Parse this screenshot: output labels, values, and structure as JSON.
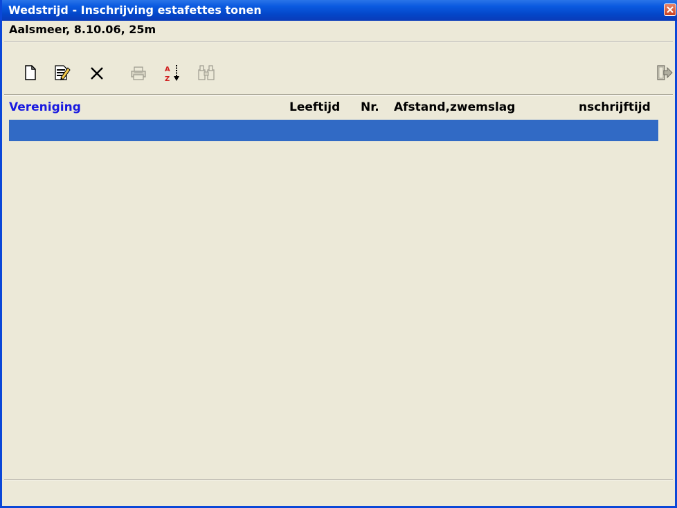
{
  "window": {
    "title": "Wedstrijd - Inschrijving estafettes tonen",
    "subtitle": "Aalsmeer, 8.10.06, 25m"
  },
  "toolbar": {
    "buttons": [
      {
        "name": "new-document-icon",
        "enabled": true
      },
      {
        "name": "edit-document-icon",
        "enabled": true
      },
      {
        "name": "delete-icon",
        "enabled": true
      },
      {
        "name": "printer-icon",
        "enabled": false
      },
      {
        "name": "sort-az-icon",
        "enabled": true
      },
      {
        "name": "binoculars-icon",
        "enabled": false
      },
      {
        "name": "exit-icon",
        "enabled": true
      }
    ]
  },
  "table": {
    "columns": [
      "Vereniging",
      "Leeftijd",
      "Nr.",
      "Afstand,zwemslag",
      "nschrijftijd"
    ],
    "rows": [
      {
        "vereniging": "",
        "leeftijd": "",
        "nr": "",
        "afstand": "",
        "inschrijftijd": "",
        "selected": true
      }
    ]
  },
  "colors": {
    "selection": "#316ac5",
    "header_accent": "#1a1ae0",
    "titlebar": "#0a5ae0"
  }
}
